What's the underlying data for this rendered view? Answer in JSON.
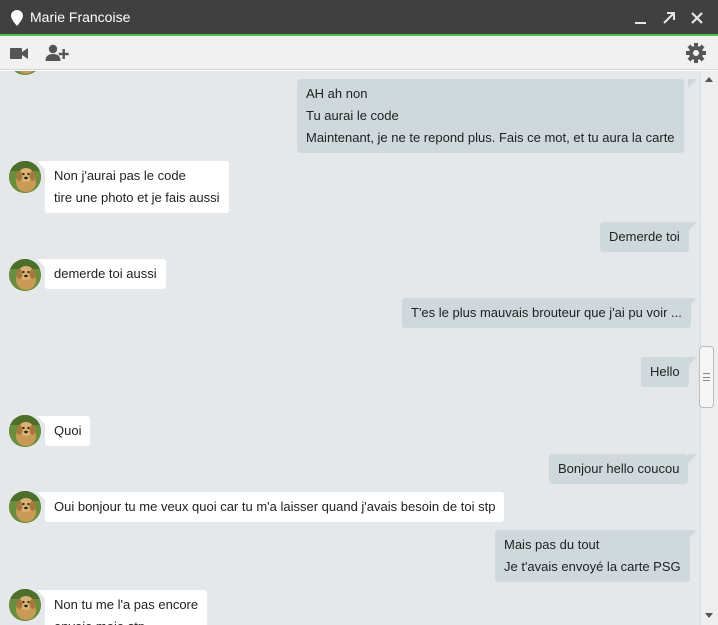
{
  "window": {
    "title": "Marie Francoise",
    "accent_color": "#4cc14c",
    "titlebar_color": "#404040",
    "icons": [
      "location-pin-icon",
      "minimize-icon",
      "pop-out-icon",
      "close-icon"
    ]
  },
  "toolbar": {
    "icons": [
      "video-camera-icon",
      "add-person-icon",
      "gear-icon"
    ]
  },
  "messages": [
    {
      "from": "me",
      "lines": [
        "AH ah non",
        "Tu aurai le code",
        "Maintenant, je ne te repond plus. Fais ce mot, et tu aura la carte"
      ]
    },
    {
      "from": "contact",
      "lines": [
        "Non j'aurai pas le code",
        "tire une photo et je fais aussi"
      ]
    },
    {
      "from": "me",
      "lines": [
        "Demerde toi"
      ]
    },
    {
      "from": "contact",
      "lines": [
        "demerde toi aussi"
      ]
    },
    {
      "from": "me",
      "lines": [
        "T'es le plus mauvais brouteur que j'ai pu voir ..."
      ]
    },
    {
      "from": "me",
      "lines": [
        "Hello"
      ]
    },
    {
      "from": "contact",
      "lines": [
        "Quoi"
      ]
    },
    {
      "from": "me",
      "lines": [
        "Bonjour hello coucou"
      ]
    },
    {
      "from": "contact",
      "lines": [
        "Oui bonjour tu me veux quoi car tu m'a laisser quand j'avais besoin de toi stp"
      ]
    },
    {
      "from": "me",
      "lines": [
        "Mais pas du tout",
        "Je t'avais envoyé la carte PSG"
      ]
    },
    {
      "from": "contact",
      "lines": [
        "Non tu me l'a pas encore",
        "envoie moie stp"
      ]
    }
  ],
  "colors": {
    "chat_background": "#e5e8eb",
    "outgoing_bubble": "#cfd8dc",
    "incoming_bubble": "#ffffff"
  }
}
